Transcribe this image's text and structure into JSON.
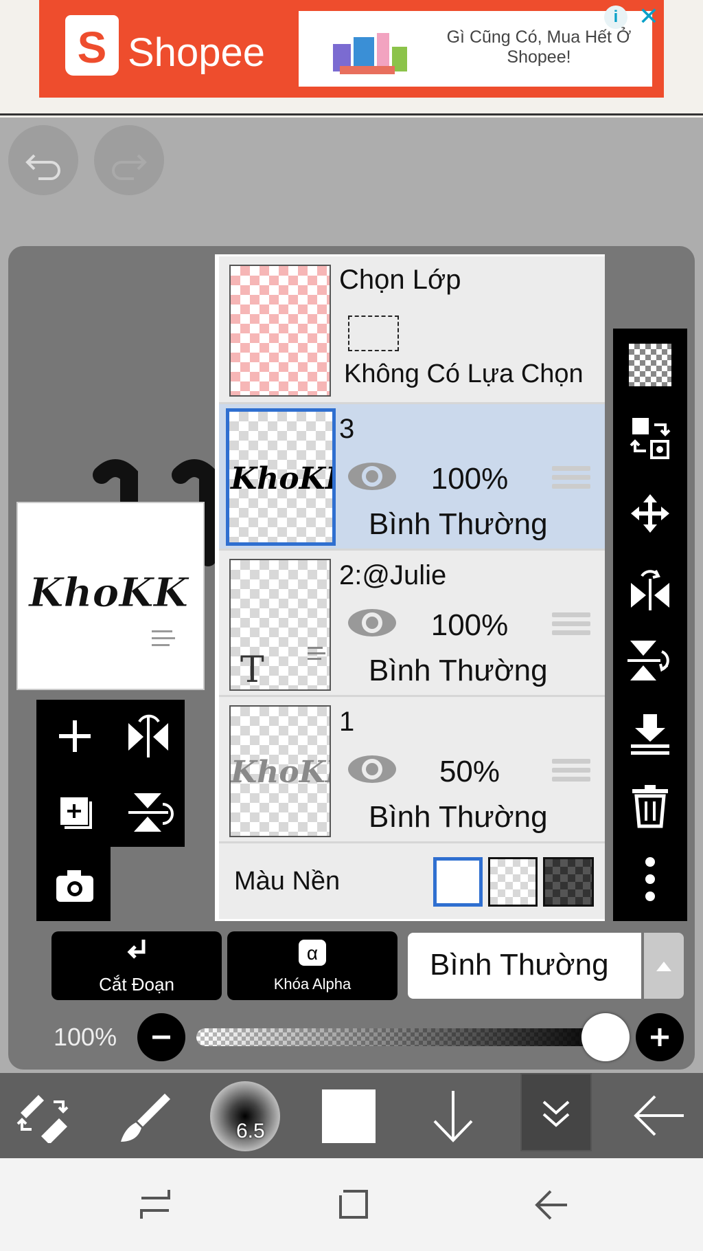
{
  "ad": {
    "brand": "Shopee",
    "logo_letter": "S",
    "tagline": "Gì Cũng Có, Mua Hết Ở Shopee!",
    "info_icon": "info-icon",
    "close_icon": "close-icon",
    "colors": {
      "brand": "#ee4d2d"
    }
  },
  "history": {
    "undo_icon": "undo-icon",
    "redo_icon": "redo-icon"
  },
  "preview": {
    "art_text": "KhoKK"
  },
  "layer_panel": {
    "selection": {
      "title": "Chọn Lớp",
      "status": "Không Có Lựa Chọn"
    },
    "layers": [
      {
        "name": "3",
        "opacity": "100%",
        "blend": "Bình Thường",
        "selected": true,
        "thumb_text": "KhoKK"
      },
      {
        "name": "2:@Julie",
        "opacity": "100%",
        "blend": "Bình Thường",
        "selected": false,
        "thumb_text": "T"
      },
      {
        "name": "1",
        "opacity": "50%",
        "blend": "Bình Thường",
        "selected": false,
        "thumb_text": "KhoKK"
      }
    ],
    "background": {
      "label": "Màu Nền",
      "options": [
        "white",
        "transparent",
        "dark"
      ],
      "selected": "white"
    }
  },
  "layer_tools": [
    "add-layer-icon",
    "flip-horizontal-icon",
    "duplicate-layer-icon",
    "flip-vertical-icon",
    "camera-icon"
  ],
  "right_toolbar": [
    "transparency-icon",
    "swap-icon",
    "move-icon",
    "flip-horizontal-icon",
    "flip-vertical-icon",
    "merge-down-icon",
    "trash-icon",
    "more-icon"
  ],
  "actions": {
    "clip_label": "Cắt Đoạn",
    "alpha_lock_label": "Khóa Alpha",
    "alpha_symbol": "α",
    "blend_mode": "Bình Thường",
    "opacity_label": "100%",
    "opacity_value": 1.0
  },
  "bottom_toolbar": {
    "brush_size": "6.5",
    "color": "#ffffff"
  },
  "colors": {
    "selected_layer": "#cbd9ec",
    "accent": "#2f6fd0"
  }
}
